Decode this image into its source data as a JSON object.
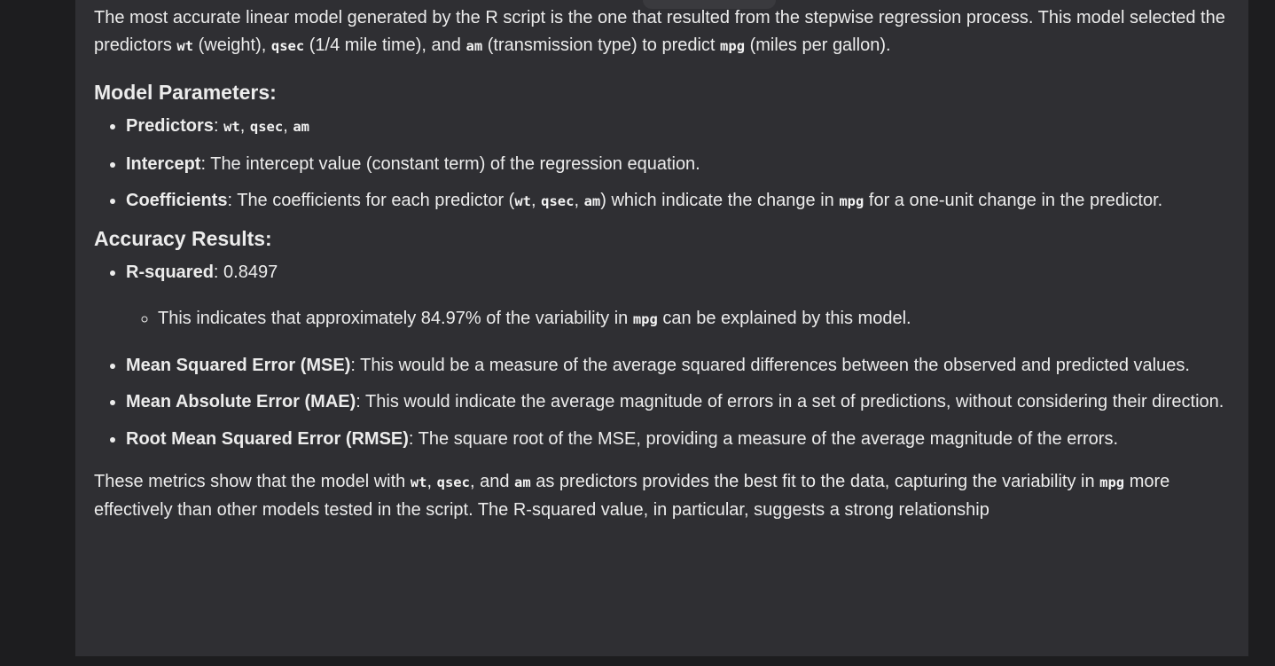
{
  "intro": {
    "t1": "The most accurate linear model generated by the R script is the one that resulted from the stepwise regression process. This model selected the predictors ",
    "c1": "wt",
    "t2": " (weight), ",
    "c2": "qsec",
    "t3": " (1/4 mile time), and ",
    "c3": "am",
    "t4": " (transmission type) to predict ",
    "c4": "mpg",
    "t5": " (miles per gallon)."
  },
  "model_params": {
    "heading": "Model Parameters:",
    "predictors": {
      "label": "Predictors",
      "sep": ": ",
      "c1": "wt",
      "comma1": ", ",
      "c2": "qsec",
      "comma2": ", ",
      "c3": "am"
    },
    "intercept": {
      "label": "Intercept",
      "text": ": The intercept value (constant term) of the regression equation."
    },
    "coefficients": {
      "label": "Coefficients",
      "t1": ": The coefficients for each predictor (",
      "c1": "wt",
      "comma1": ", ",
      "c2": "qsec",
      "comma2": ", ",
      "c3": "am",
      "t2": ") which indicate the change in ",
      "c4": "mpg",
      "t3": " for a one-unit change in the predictor."
    }
  },
  "accuracy": {
    "heading": "Accuracy Results:",
    "r_squared": {
      "label": "R-squared",
      "value_text": ": 0.8497",
      "sub_t1": "This indicates that approximately 84.97% of the variability in ",
      "sub_c1": "mpg",
      "sub_t2": " can be explained by this model."
    },
    "mse": {
      "label": "Mean Squared Error (MSE)",
      "text": ": This would be a measure of the average squared differences between the observed and predicted values."
    },
    "mae": {
      "label": "Mean Absolute Error (MAE)",
      "text": ": This would indicate the average magnitude of errors in a set of predictions, without considering their direction."
    },
    "rmse": {
      "label": "Root Mean Squared Error (RMSE)",
      "text": ": The square root of the MSE, providing a measure of the average magnitude of the errors."
    }
  },
  "outro": {
    "t1": "These metrics show that the model with ",
    "c1": "wt",
    "t2": ", ",
    "c2": "qsec",
    "t3": ", and ",
    "c3": "am",
    "t4": " as predictors provides the best fit to the data, capturing the variability in ",
    "c4": "mpg",
    "t5": " more effectively than other models tested in the script. The R-squared value, in particular, suggests a strong relationship"
  }
}
